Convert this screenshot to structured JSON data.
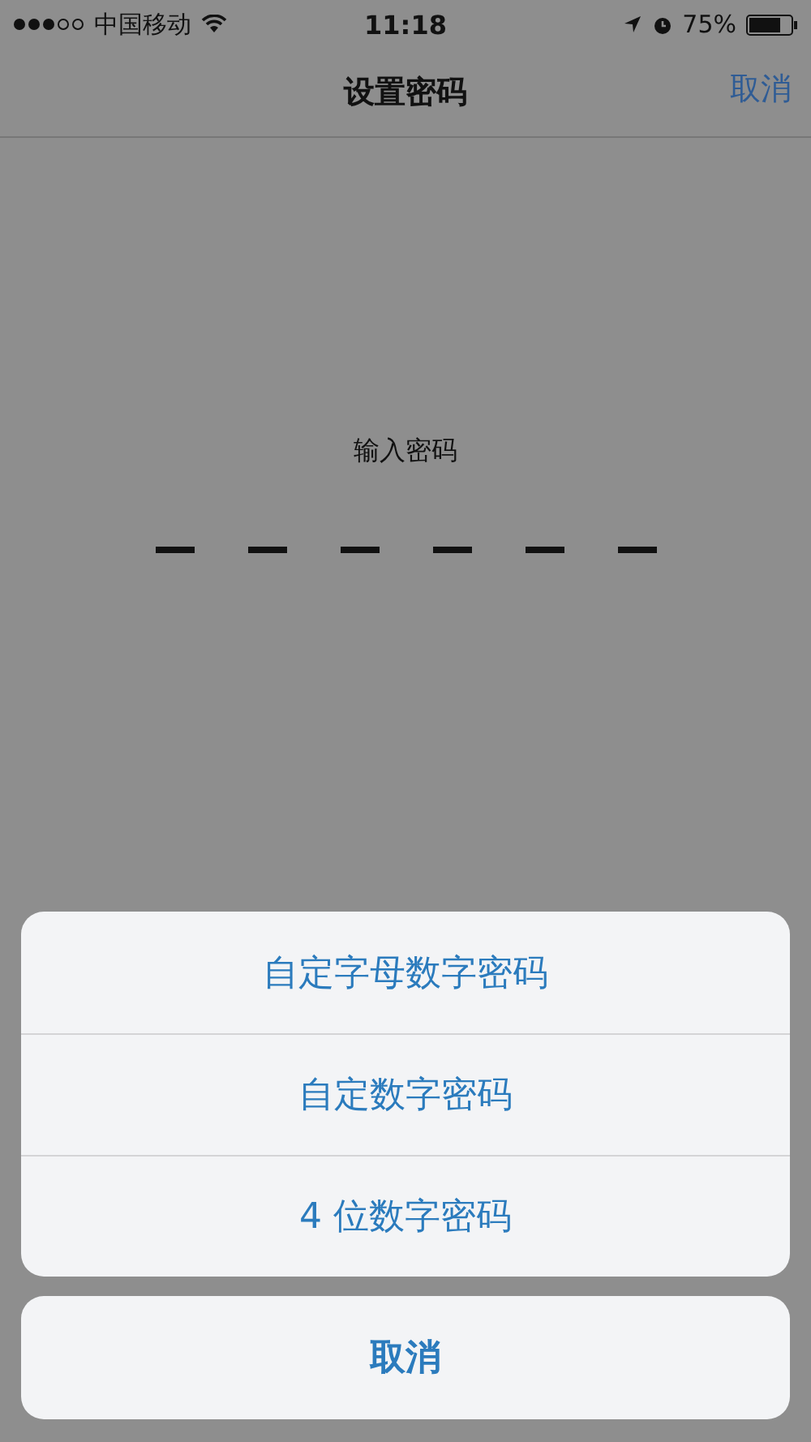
{
  "status_bar": {
    "carrier": "中国移动",
    "time": "11:18",
    "battery": "75%"
  },
  "nav": {
    "title": "设置密码",
    "action": "取消"
  },
  "prompt": "输入密码",
  "code_slots": [
    {
      "filled": false
    },
    {
      "filled": false
    },
    {
      "filled": false
    },
    {
      "filled": false
    },
    {
      "filled": false
    },
    {
      "filled": false
    }
  ],
  "action_sheet": {
    "options": [
      "自定字母数字密码",
      "自定数字密码",
      "4 位数字密码"
    ],
    "cancel": "取消"
  }
}
